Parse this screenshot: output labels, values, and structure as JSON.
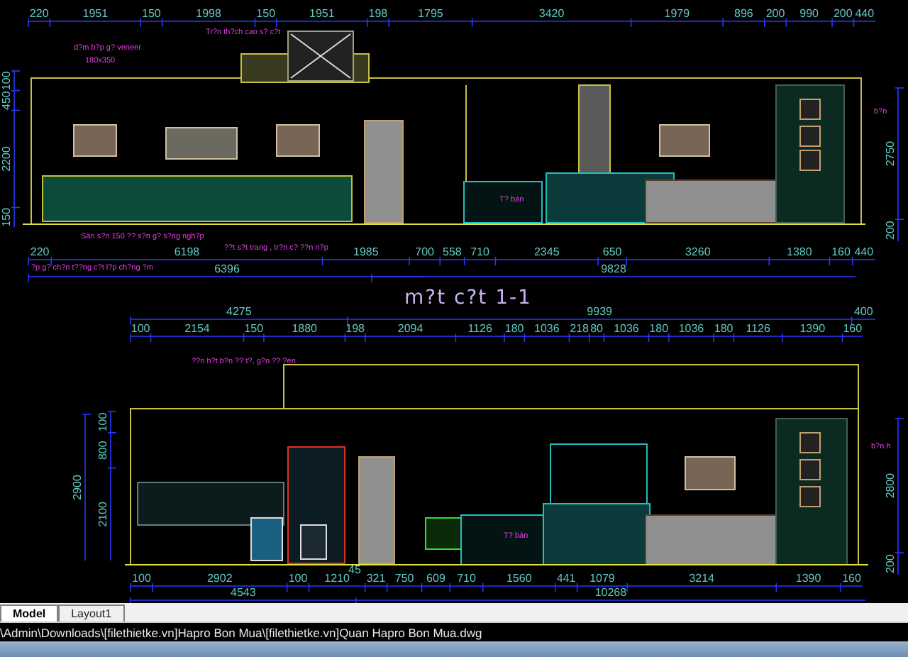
{
  "drawing": {
    "elevation": {
      "dimension_rows": [
        [
          "220",
          "1951",
          "150",
          "1998",
          "150",
          "1951",
          "198",
          "1795",
          "3420",
          "1979",
          "896",
          "200",
          "990",
          "200",
          "440"
        ],
        [
          "220",
          "6198",
          "1985",
          "700",
          "558",
          "710",
          "2345",
          "650",
          "3260",
          "1380",
          "160",
          "440"
        ],
        [
          "6396"
        ],
        [
          "9828"
        ]
      ],
      "vertical_dimensions": [
        [
          "100",
          "450",
          "2200",
          "150"
        ],
        [
          "2750",
          "200"
        ]
      ],
      "notes": [
        "Tr?n th?ch cao s? c?t",
        "d?m b?p g? veneer",
        "180x350",
        "Sàn s?n 150 ?? s?n g? s?ng ngh?p",
        "??t s?t trang , tr?n c? ??n n?p",
        "?p g? ch?n t??ng c?t l?p ch?ng ?m",
        "T? bán",
        "b?n"
      ]
    },
    "title": "m?t c?t 1-1",
    "section": {
      "dimension_rows": [
        [
          "4275",
          "9939",
          "400"
        ],
        [
          "100",
          "2154",
          "150",
          "1880",
          "198",
          "2094",
          "1126",
          "180",
          "1036",
          "218",
          "80",
          "1036",
          "180",
          "1036",
          "180",
          "1126",
          "1390",
          "160"
        ],
        [
          "100",
          "2902",
          "100",
          "1210",
          "321",
          "750",
          "609",
          "710",
          "1560",
          "441",
          "1079",
          "3214",
          "1390",
          "160"
        ],
        [
          "4543",
          "10268"
        ]
      ],
      "vertical_dimensions": [
        [
          "2900"
        ],
        [
          "100",
          "800",
          "2100"
        ],
        [
          "2800",
          "200"
        ]
      ],
      "extra_dimension": "45",
      "notes": [
        "??n h?t b?n ?? t?, g?n ?? ?èn",
        "T? bán",
        "b?n h"
      ]
    }
  },
  "tabs": [
    {
      "label": "Model",
      "selected": true
    },
    {
      "label": "Layout1",
      "selected": false
    }
  ],
  "command_line": "\\Admin\\Downloads\\[filethietke.vn]Hapro Bon Mua\\[filethietke.vn]Quan Hapro Bon Mua.dwg"
}
